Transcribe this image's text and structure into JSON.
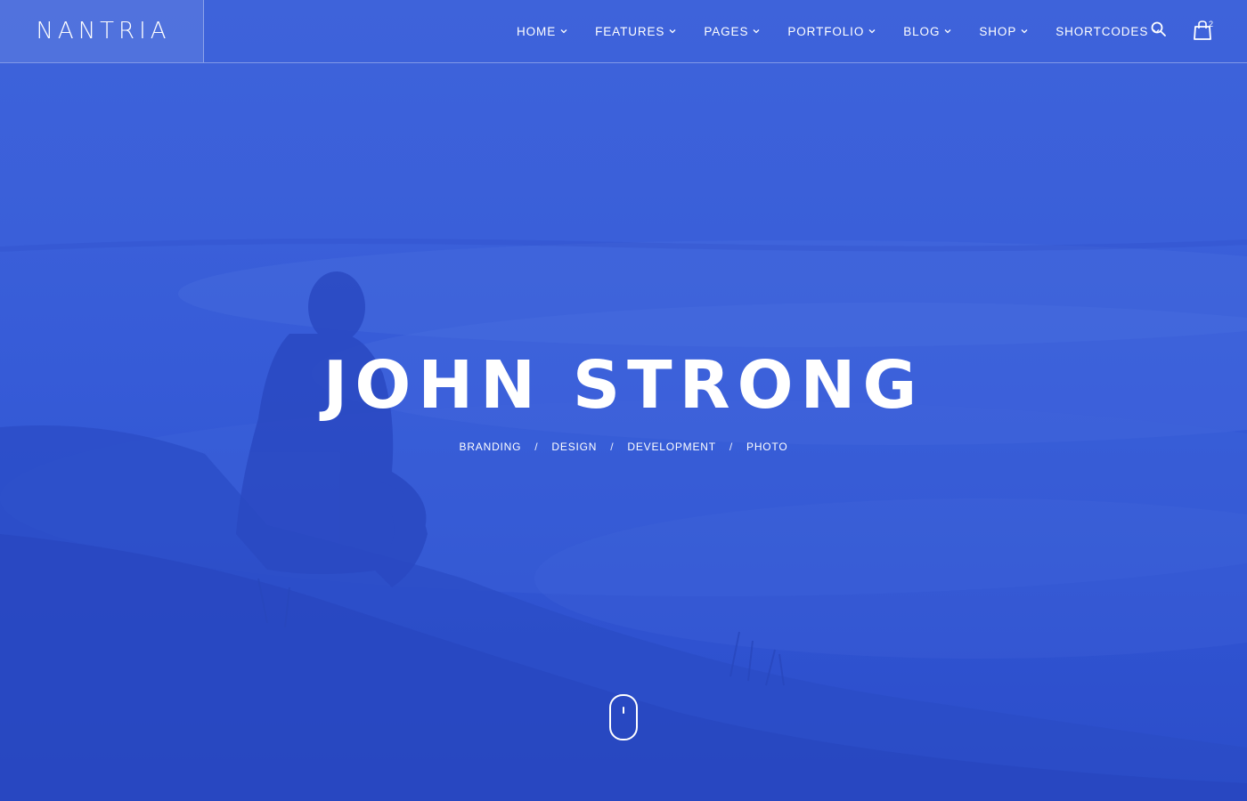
{
  "header": {
    "logo": "NANTRIA",
    "nav": [
      {
        "label": "HOME"
      },
      {
        "label": "FEATURES"
      },
      {
        "label": "PAGES"
      },
      {
        "label": "PORTFOLIO"
      },
      {
        "label": "BLOG"
      },
      {
        "label": "SHOP"
      },
      {
        "label": "SHORTCODES"
      }
    ],
    "cart_count": "2"
  },
  "hero": {
    "title": "JOHN STRONG",
    "tags": [
      "BRANDING",
      "DESIGN",
      "DEVELOPMENT",
      "PHOTO"
    ],
    "separator": "/"
  },
  "colors": {
    "overlay_blue": "#3358d6",
    "text": "#ffffff"
  },
  "icons": {
    "search": "search-icon",
    "cart": "shopping-bag-icon",
    "scroll": "mouse-scroll-icon",
    "chevron": "chevron-down-icon"
  }
}
